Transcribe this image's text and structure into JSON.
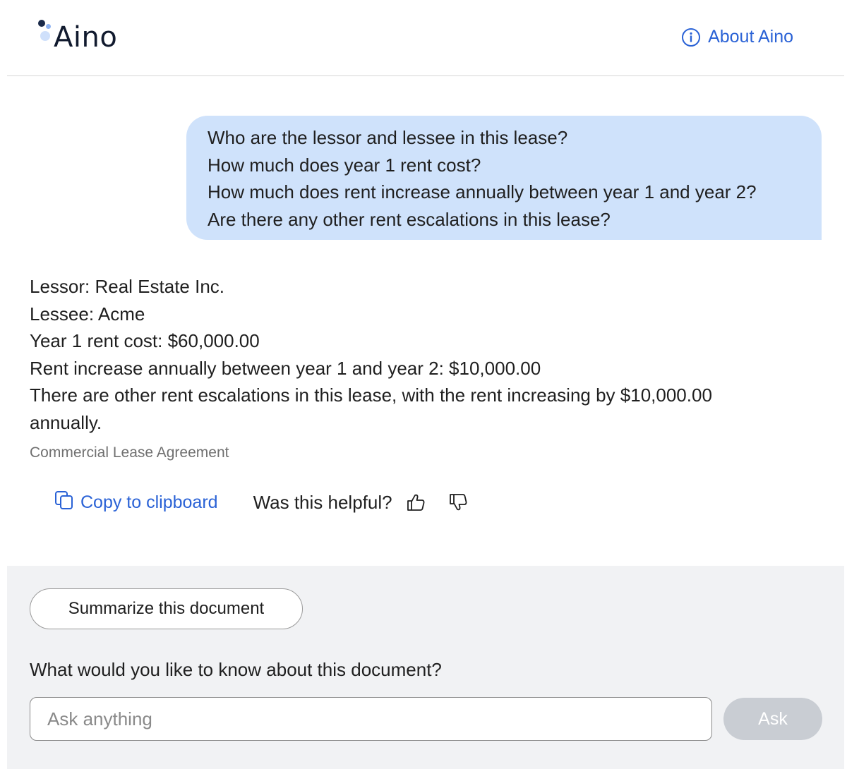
{
  "header": {
    "logo_text": "Aino",
    "about_label": "About Aino"
  },
  "user_message": {
    "lines": [
      "Who are the lessor and lessee in this lease?",
      "How much does year 1 rent cost?",
      "How much does rent increase annually between year 1 and year 2?",
      "Are there any other rent escalations in this lease?"
    ]
  },
  "answer": {
    "lines": [
      "Lessor: Real Estate Inc.",
      "Lessee: Acme",
      "Year 1 rent cost: $60,000.00",
      "Rent increase annually between year 1 and year 2: $10,000.00",
      "There are other rent escalations in this lease, with the rent increasing by $10,000.00",
      "annually."
    ],
    "source": "Commercial Lease Agreement"
  },
  "actions": {
    "copy_label": "Copy to clipboard",
    "helpful_label": "Was this helpful?"
  },
  "composer": {
    "summarize_label": "Summarize this document",
    "prompt_label": "What would you like to know about this document?",
    "input_placeholder": "Ask anything",
    "input_value": "",
    "ask_label": "Ask"
  },
  "colors": {
    "accent": "#2a62d6",
    "user_bubble": "#cfe2fb",
    "panel_bg": "#f1f2f4",
    "ask_disabled": "#c9cdd3"
  },
  "icons": [
    "info-icon",
    "copy-icon",
    "thumbs-up-icon",
    "thumbs-down-icon"
  ]
}
